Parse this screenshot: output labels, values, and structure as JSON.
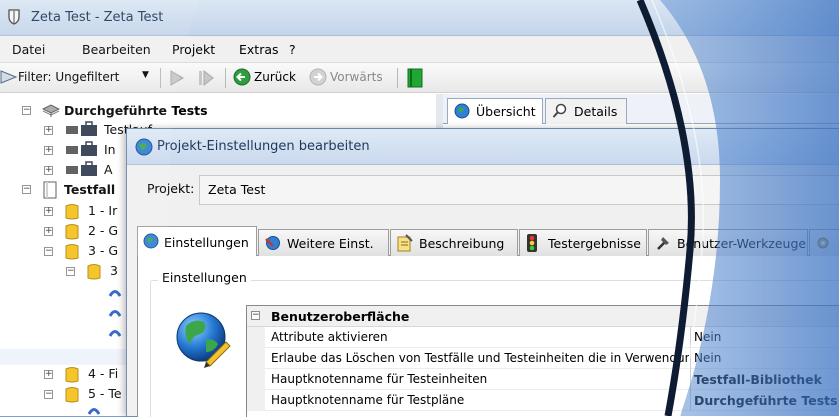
{
  "main_window": {
    "title": "Zeta Test - Zeta Test",
    "menu": [
      "Datei",
      "Bearbeiten",
      "Projekt",
      "Extras",
      "?"
    ],
    "toolbar": {
      "filter_label": "Filter: Ungefiltert",
      "back_label": "Zurück",
      "forward_label": "Vorwärts"
    },
    "content_tabs": [
      "Übersicht",
      "Details"
    ]
  },
  "tree": {
    "nodes": [
      {
        "label": "Durchgeführte Tests",
        "bold": true
      },
      {
        "label": "Testlauf"
      },
      {
        "label": "In"
      },
      {
        "label": "A"
      },
      {
        "label": "Testfall",
        "bold": true
      },
      {
        "label": "1 - Ir"
      },
      {
        "label": "2 - G"
      },
      {
        "label": "3 - G"
      },
      {
        "label": "3"
      },
      {
        "label": "4 - Fi"
      },
      {
        "label": "5 - Te"
      }
    ]
  },
  "dialog": {
    "title": "Projekt-Einstellungen bearbeiten",
    "project_label": "Projekt:",
    "project_value": "Zeta Test",
    "tabs": [
      "Einstellungen",
      "Weitere Einst.",
      "Beschreibung",
      "Testergebnisse",
      "Benutzer-Werkzeuge"
    ],
    "group_label": "Einstellungen",
    "property_grid": {
      "category": "Benutzeroberfläche",
      "rows": [
        {
          "name": "Attribute aktivieren",
          "value": "Nein",
          "value_bold": false
        },
        {
          "name": "Erlaube das Löschen von Testfälle und Testeinheiten die in Verwendung sind",
          "value": "Nein",
          "value_bold": false
        },
        {
          "name": "Hauptknotenname für Testeinheiten",
          "value": "Testfall-Bibliothek",
          "value_bold": true
        },
        {
          "name": "Hauptknotenname für Testpläne",
          "value": "Durchgeführte Tests",
          "value_bold": true
        }
      ]
    }
  },
  "colors": {
    "accent_blue": "#1f4e9c",
    "title_text": "#1e395b",
    "green_button": "#1e9b2e"
  }
}
